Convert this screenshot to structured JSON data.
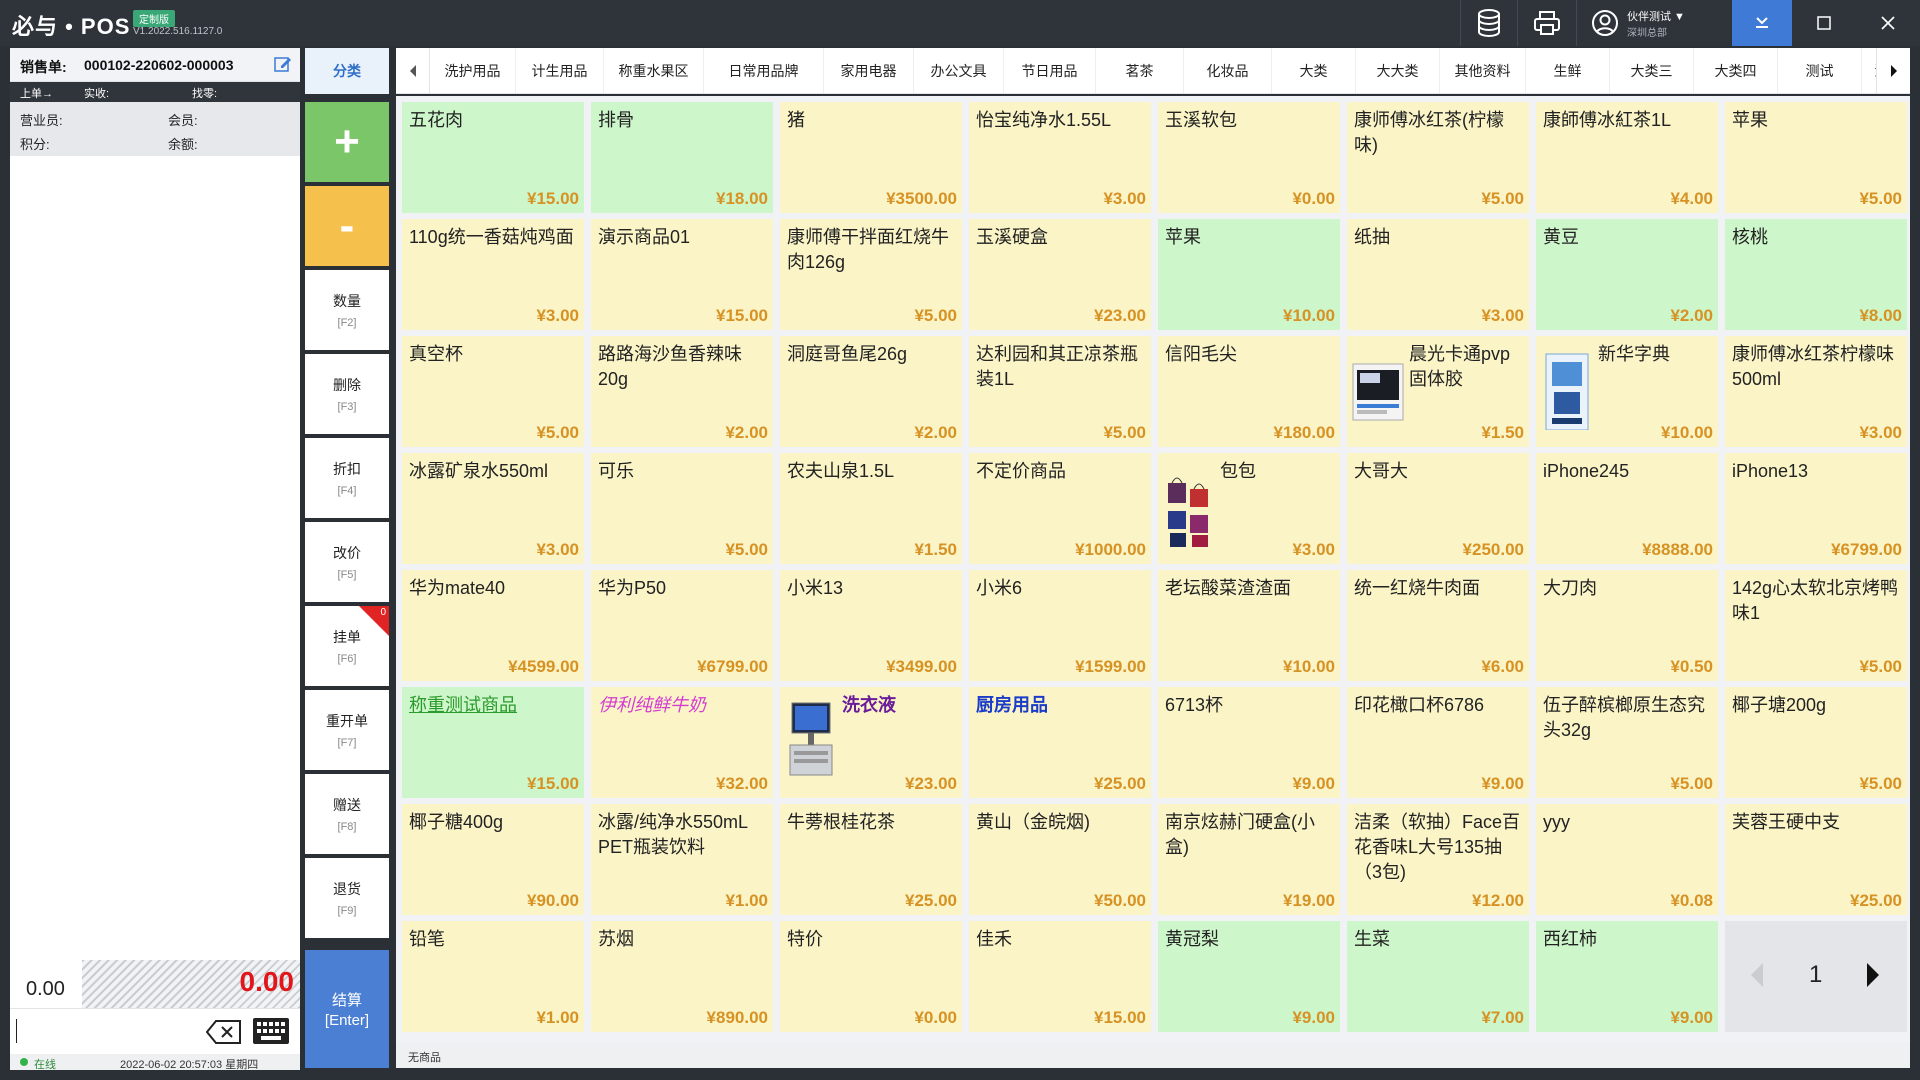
{
  "app": {
    "title": "必与 • POS",
    "edition_badge": "定制版",
    "version": "V1.2022.516.1127.0"
  },
  "titlebar": {
    "user_name": "伙伴测试 ▼",
    "store_name": "深圳总部",
    "icons": [
      "database-icon",
      "printer-icon",
      "user-icon",
      "collapse-icon",
      "maximize-icon",
      "close-icon"
    ]
  },
  "order": {
    "label": "销售单:",
    "number": "000102-220602-000003",
    "prev_label": "上单→",
    "paid_label": "实收:",
    "change_label": "找零:",
    "clerk_label": "营业员:",
    "member_label": "会员:",
    "points_label": "积分:",
    "balance_label": "余额:",
    "total_left": "0.00",
    "total_right": "0.00",
    "status": "在线",
    "datetime": "2022-06-02 20:57:03 星期四"
  },
  "functions": {
    "category": "分类",
    "plus": "+",
    "minus": "-",
    "qty": {
      "label": "数量",
      "key": "[F2]"
    },
    "delete": {
      "label": "删除",
      "key": "[F3]"
    },
    "discount": {
      "label": "折扣",
      "key": "[F4]"
    },
    "reprice": {
      "label": "改价",
      "key": "[F5]"
    },
    "hold": {
      "label": "挂单",
      "key": "[F6]",
      "badge": "0"
    },
    "reopen": {
      "label": "重开单",
      "key": "[F7]"
    },
    "gift": {
      "label": "赠送",
      "key": "[F8]"
    },
    "refund": {
      "label": "退货",
      "key": "[F9]"
    },
    "checkout": {
      "label": "结算",
      "key": "[Enter]"
    }
  },
  "categories": [
    "洗护用品",
    "计生用品",
    "称重水果区",
    "日常用品牌",
    "家用电器",
    "办公文具",
    "节日用品",
    "茗茶",
    "化妆品",
    "大类",
    "大大类",
    "其他资料",
    "生鲜",
    "大类三",
    "大类四",
    "测试",
    "测"
  ],
  "products": [
    {
      "name": "五花肉",
      "price": "¥15.00",
      "bg": "g"
    },
    {
      "name": "排骨",
      "price": "¥18.00",
      "bg": "g"
    },
    {
      "name": "猪",
      "price": "¥3500.00",
      "bg": "y"
    },
    {
      "name": "怡宝纯净水1.55L",
      "price": "¥3.00",
      "bg": "y"
    },
    {
      "name": "玉溪软包",
      "price": "¥0.00",
      "bg": "y"
    },
    {
      "name": "康师傅冰红茶(柠檬味)",
      "price": "¥5.00",
      "bg": "y"
    },
    {
      "name": "康師傅冰紅茶1L",
      "price": "¥4.00",
      "bg": "y"
    },
    {
      "name": "苹果",
      "price": "¥5.00",
      "bg": "y"
    },
    {
      "name": "110g统一香菇炖鸡面",
      "price": "¥3.00",
      "bg": "y"
    },
    {
      "name": "演示商品01",
      "price": "¥15.00",
      "bg": "y"
    },
    {
      "name": "康师傅干拌面红烧牛肉126g",
      "price": "¥5.00",
      "bg": "y"
    },
    {
      "name": "玉溪硬盒",
      "price": "¥23.00",
      "bg": "y"
    },
    {
      "name": "苹果",
      "price": "¥10.00",
      "bg": "g"
    },
    {
      "name": "纸抽",
      "price": "¥3.00",
      "bg": "y"
    },
    {
      "name": "黄豆",
      "price": "¥2.00",
      "bg": "g"
    },
    {
      "name": "核桃",
      "price": "¥8.00",
      "bg": "g"
    },
    {
      "name": "真空杯",
      "price": "¥5.00",
      "bg": "y"
    },
    {
      "name": "路路海沙鱼香辣味20g",
      "price": "¥2.00",
      "bg": "y"
    },
    {
      "name": "洞庭哥鱼尾26g",
      "price": "¥2.00",
      "bg": "y"
    },
    {
      "name": "达利园和其正凉茶瓶装1L",
      "price": "¥5.00",
      "bg": "y"
    },
    {
      "name": "信阳毛尖",
      "price": "¥180.00",
      "bg": "y"
    },
    {
      "name": "晨光卡通pvp固体胶",
      "price": "¥1.50",
      "bg": "y",
      "img": "screen"
    },
    {
      "name": "新华字典",
      "price": "¥10.00",
      "bg": "y",
      "img": "book"
    },
    {
      "name": "康师傅冰红茶柠檬味500ml",
      "price": "¥3.00",
      "bg": "y"
    },
    {
      "name": "冰露矿泉水550ml",
      "price": "¥3.00",
      "bg": "y"
    },
    {
      "name": "可乐",
      "price": "¥5.00",
      "bg": "y"
    },
    {
      "name": "农夫山泉1.5L",
      "price": "¥1.50",
      "bg": "y"
    },
    {
      "name": "不定价商品",
      "price": "¥1000.00",
      "bg": "y"
    },
    {
      "name": "包包",
      "price": "¥3.00",
      "bg": "y",
      "img": "bags"
    },
    {
      "name": "大哥大",
      "price": "¥250.00",
      "bg": "y"
    },
    {
      "name": "iPhone245",
      "price": "¥8888.00",
      "bg": "y"
    },
    {
      "name": "iPhone13",
      "price": "¥6799.00",
      "bg": "y"
    },
    {
      "name": "华为mate40",
      "price": "¥4599.00",
      "bg": "y"
    },
    {
      "name": "华为P50",
      "price": "¥6799.00",
      "bg": "y"
    },
    {
      "name": "小米13",
      "price": "¥3499.00",
      "bg": "y"
    },
    {
      "name": "小米6",
      "price": "¥1599.00",
      "bg": "y"
    },
    {
      "name": "老坛酸菜渣渣面",
      "price": "¥10.00",
      "bg": "y"
    },
    {
      "name": "统一红烧牛肉面",
      "price": "¥6.00",
      "bg": "y"
    },
    {
      "name": "大刀肉",
      "price": "¥0.50",
      "bg": "y"
    },
    {
      "name": "142g心太软北京烤鸭味1",
      "price": "¥5.00",
      "bg": "y"
    },
    {
      "name": "称重测试商品",
      "price": "¥15.00",
      "bg": "g",
      "style": "underline"
    },
    {
      "name": "伊利纯鲜牛奶",
      "price": "¥32.00",
      "bg": "y",
      "style": "italic"
    },
    {
      "name": "洗衣液",
      "price": "¥23.00",
      "bg": "y",
      "style": "bold",
      "img": "kiosk"
    },
    {
      "name": "厨房用品",
      "price": "¥25.00",
      "bg": "y",
      "style": "blue"
    },
    {
      "name": "6713杯",
      "price": "¥9.00",
      "bg": "y"
    },
    {
      "name": "印花橄口杯6786",
      "price": "¥9.00",
      "bg": "y"
    },
    {
      "name": "伍子醉槟榔原生态究头32g",
      "price": "¥5.00",
      "bg": "y"
    },
    {
      "name": "椰子塘200g",
      "price": "¥5.00",
      "bg": "y"
    },
    {
      "name": "椰子糖400g",
      "price": "¥90.00",
      "bg": "y"
    },
    {
      "name": "冰露/纯净水550mL PET瓶装饮料",
      "price": "¥1.00",
      "bg": "y"
    },
    {
      "name": "牛蒡根桂花茶",
      "price": "¥25.00",
      "bg": "y"
    },
    {
      "name": "黄山（金皖烟)",
      "price": "¥50.00",
      "bg": "y"
    },
    {
      "name": "南京炫赫门硬盒(小盒)",
      "price": "¥19.00",
      "bg": "y"
    },
    {
      "name": "洁柔（软抽）Face百花香味L大号135抽（3包)",
      "price": "¥12.00",
      "bg": "y"
    },
    {
      "name": "yyy",
      "price": "¥0.08",
      "bg": "y"
    },
    {
      "name": "芙蓉王硬中支",
      "price": "¥25.00",
      "bg": "y"
    },
    {
      "name": "铅笔",
      "price": "¥1.00",
      "bg": "y"
    },
    {
      "name": "苏烟",
      "price": "¥890.00",
      "bg": "y"
    },
    {
      "name": "特价",
      "price": "¥0.00",
      "bg": "y"
    },
    {
      "name": "佳禾",
      "price": "¥15.00",
      "bg": "y"
    },
    {
      "name": "黄冠梨",
      "price": "¥9.00",
      "bg": "g"
    },
    {
      "name": "生菜",
      "price": "¥7.00",
      "bg": "g"
    },
    {
      "name": "西红柿",
      "price": "¥9.00",
      "bg": "g"
    }
  ],
  "pager": {
    "page": "1"
  },
  "grid_status": "无商品"
}
